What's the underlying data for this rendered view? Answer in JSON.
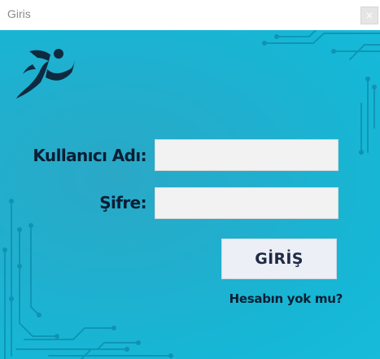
{
  "window": {
    "title": "Giris",
    "close_glyph": "×"
  },
  "form": {
    "username_label": "Kullanıcı Adı:",
    "username_value": "",
    "password_label": "Şifre:",
    "password_value": "",
    "login_button": "GİRİŞ",
    "register_link": "Hesabın yok mu?"
  },
  "icons": {
    "logo": "running-person-icon",
    "close": "close-icon"
  },
  "colors": {
    "background": "#18b4d3",
    "circuit": "#0f95b4",
    "label_text": "#0b1e33",
    "field_bg": "#f2f2f2",
    "button_bg": "#eceff5"
  }
}
